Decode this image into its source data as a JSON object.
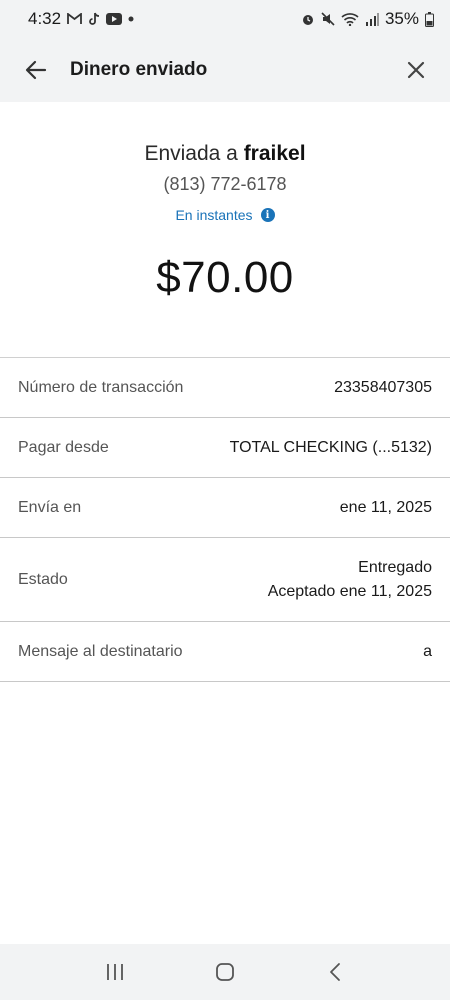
{
  "status_bar": {
    "time": "4:32",
    "battery": "35%",
    "left_icons": [
      "gmail-icon",
      "tiktok-icon",
      "youtube-icon",
      "dot-icon"
    ],
    "right_icons": [
      "alarm-icon",
      "mute-icon",
      "wifi-icon",
      "signal-icon",
      "battery-icon"
    ]
  },
  "header": {
    "title": "Dinero enviado"
  },
  "summary": {
    "sent_prefix": "Enviada a",
    "recipient": "fraikel",
    "phone": "(813) 772-6178",
    "speed": "En instantes",
    "amount": "$70.00"
  },
  "details": [
    {
      "label": "Número de transacción",
      "value": "23358407305"
    },
    {
      "label": "Pagar desde",
      "value": "TOTAL CHECKING (...5132)"
    },
    {
      "label": "Envía en",
      "value": "ene 11, 2025"
    },
    {
      "label": "Estado",
      "value": "Entregado",
      "value2": "Aceptado ene 11, 2025"
    },
    {
      "label": "Mensaje al destinatario",
      "value": "a"
    }
  ],
  "colors": {
    "accent": "#1a73b8",
    "header_bg": "#f2f3f4",
    "divider": "#c8c8c8"
  }
}
